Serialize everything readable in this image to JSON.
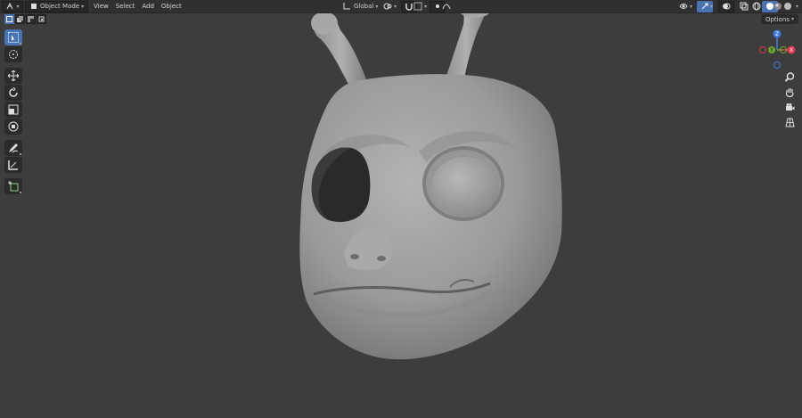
{
  "header": {
    "mode_label": "Object Mode",
    "menus": [
      "View",
      "Select",
      "Add",
      "Object"
    ],
    "transform_orientation": "Global",
    "options_label": "Options"
  },
  "left_toolbar": {
    "tools": [
      "select-box",
      "cursor",
      "move",
      "rotate",
      "scale",
      "transform",
      "annotate",
      "measure",
      "add-cube"
    ]
  },
  "navigation_gizmo": {
    "axes": {
      "x_color": "#e03a4f",
      "y_color": "#6aa82b",
      "z_color": "#3e7be0"
    },
    "z_label": "Z",
    "y_label": "Y",
    "x_label": "X"
  },
  "viewport": {
    "background": "#3d3d3d",
    "object": "sculpted creature head with antennae"
  },
  "colors": {
    "accent": "#4772b3",
    "header_bg": "#303030"
  }
}
